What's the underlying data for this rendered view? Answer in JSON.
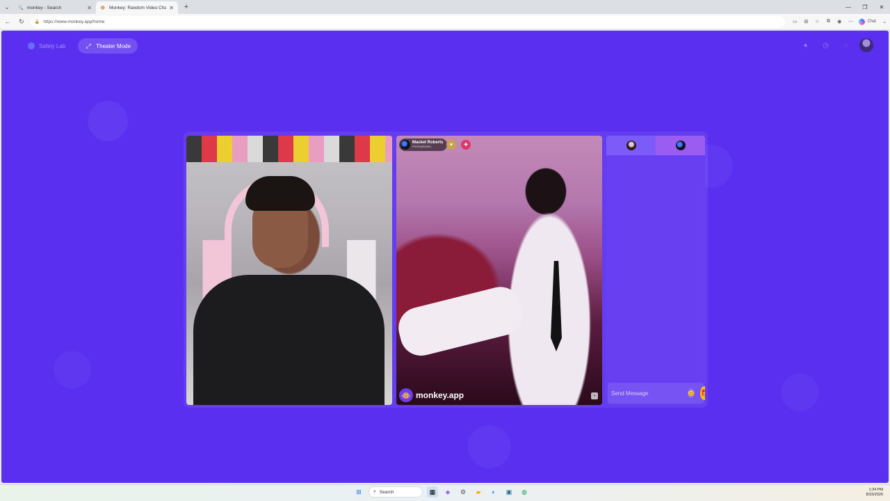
{
  "browser": {
    "tabs": [
      {
        "title": "monkey - Search",
        "active": false,
        "icon": "search-icon"
      },
      {
        "title": "Monkey: Random Video Chat",
        "active": true,
        "icon": "monkey-favicon"
      }
    ],
    "url": "https://www.monkey.app/home",
    "chat_label": "Chat"
  },
  "header": {
    "safety_lab_label": "Safety Lab",
    "theater_mode_label": "Theater Mode"
  },
  "remote_user": {
    "name": "Mackel Roberts",
    "location": "Pennsylvania"
  },
  "watermark": "monkey.app",
  "chat": {
    "placeholder": "Send Message"
  },
  "taskbar": {
    "search_label": "Search",
    "time": "1:34 PM",
    "date": "8/23/2026"
  },
  "colors": {
    "page_background": "#5a2ff0",
    "chat_panel": "#6840f2",
    "gift_button": "#f7c100"
  }
}
